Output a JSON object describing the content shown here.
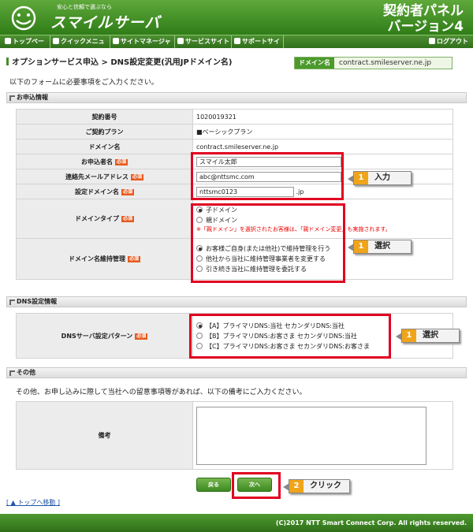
{
  "header": {
    "tagline": "安心と信頼で選ぶなら",
    "brand": "スマイルサーバ",
    "panel_line1": "契約者パネル",
    "panel_line2": "バージョン4"
  },
  "nav": {
    "items": [
      "トップページ",
      "クイックメニュー",
      "サイトマネージャー",
      "サービスサイト",
      "サポートサイト"
    ],
    "logout": "ログアウト"
  },
  "page": {
    "title": "オプションサービス申込 > DNS設定変更(汎用JPドメイン名)",
    "domain_label": "ドメイン名",
    "domain_value": "contract.smileserver.ne.jp",
    "intro": "以下のフォームに必要事項をご入力ください。"
  },
  "section1": {
    "title": "お申込情報",
    "contract_no_label": "契約番号",
    "contract_no": "1020019321",
    "plan_label": "ご契約プラン",
    "plan": "■ベーシックプラン",
    "domain_label": "ドメイン名",
    "domain": "contract.smileserver.ne.jp",
    "applicant_label": "お申込者名",
    "applicant": "スマイル太郎",
    "email_label": "連絡先メールアドレス",
    "email": "abc@nttsmc.com",
    "setdomain_label": "設定ドメイン名",
    "setdomain": "nttsmc0123",
    "setdomain_suffix": ".jp",
    "required": "必須",
    "domain_type_label": "ドメインタイプ",
    "domain_type_opt1": "子ドメイン",
    "domain_type_opt2": "親ドメイン",
    "domain_type_note": "※「親ドメイン」を選択されたお客様は、「親ドメイン変更」も実施されます。",
    "mgmt_label": "ドメイン名維持管理",
    "mgmt_opt1": "お客様ご自身(または他社)で維持管理を行う",
    "mgmt_opt2": "他社から当社に維持管理事業者を変更する",
    "mgmt_opt3": "引き続き当社に維持管理を委託する"
  },
  "section2": {
    "title": "DNS設定情報",
    "pattern_label": "DNSサーバ設定パターン",
    "opt_a": "【A】プライマリDNS:当社 セカンダリDNS:当社",
    "opt_b": "【B】プライマリDNS:お客さま セカンダリDNS:当社",
    "opt_c": "【C】プライマリDNS:お客さま セカンダリDNS:お客さま"
  },
  "section3": {
    "title": "その他",
    "desc": "その他、お申し込みに際して当社への留意事項等があれば、以下の備考にご入力ください。",
    "remarks_label": "備考"
  },
  "buttons": {
    "back": "戻る",
    "next": "次へ"
  },
  "callouts": {
    "input": {
      "num": "1",
      "text": "入力"
    },
    "select1": {
      "num": "1",
      "text": "選択"
    },
    "select2": {
      "num": "1",
      "text": "選択"
    },
    "click": {
      "num": "2",
      "text": "クリック"
    }
  },
  "footer": {
    "back_to_top": "[ ▲ トップへ移動 ]",
    "copyright": "(C)2017 NTT Smart Connect Corp. All rights reserved."
  }
}
